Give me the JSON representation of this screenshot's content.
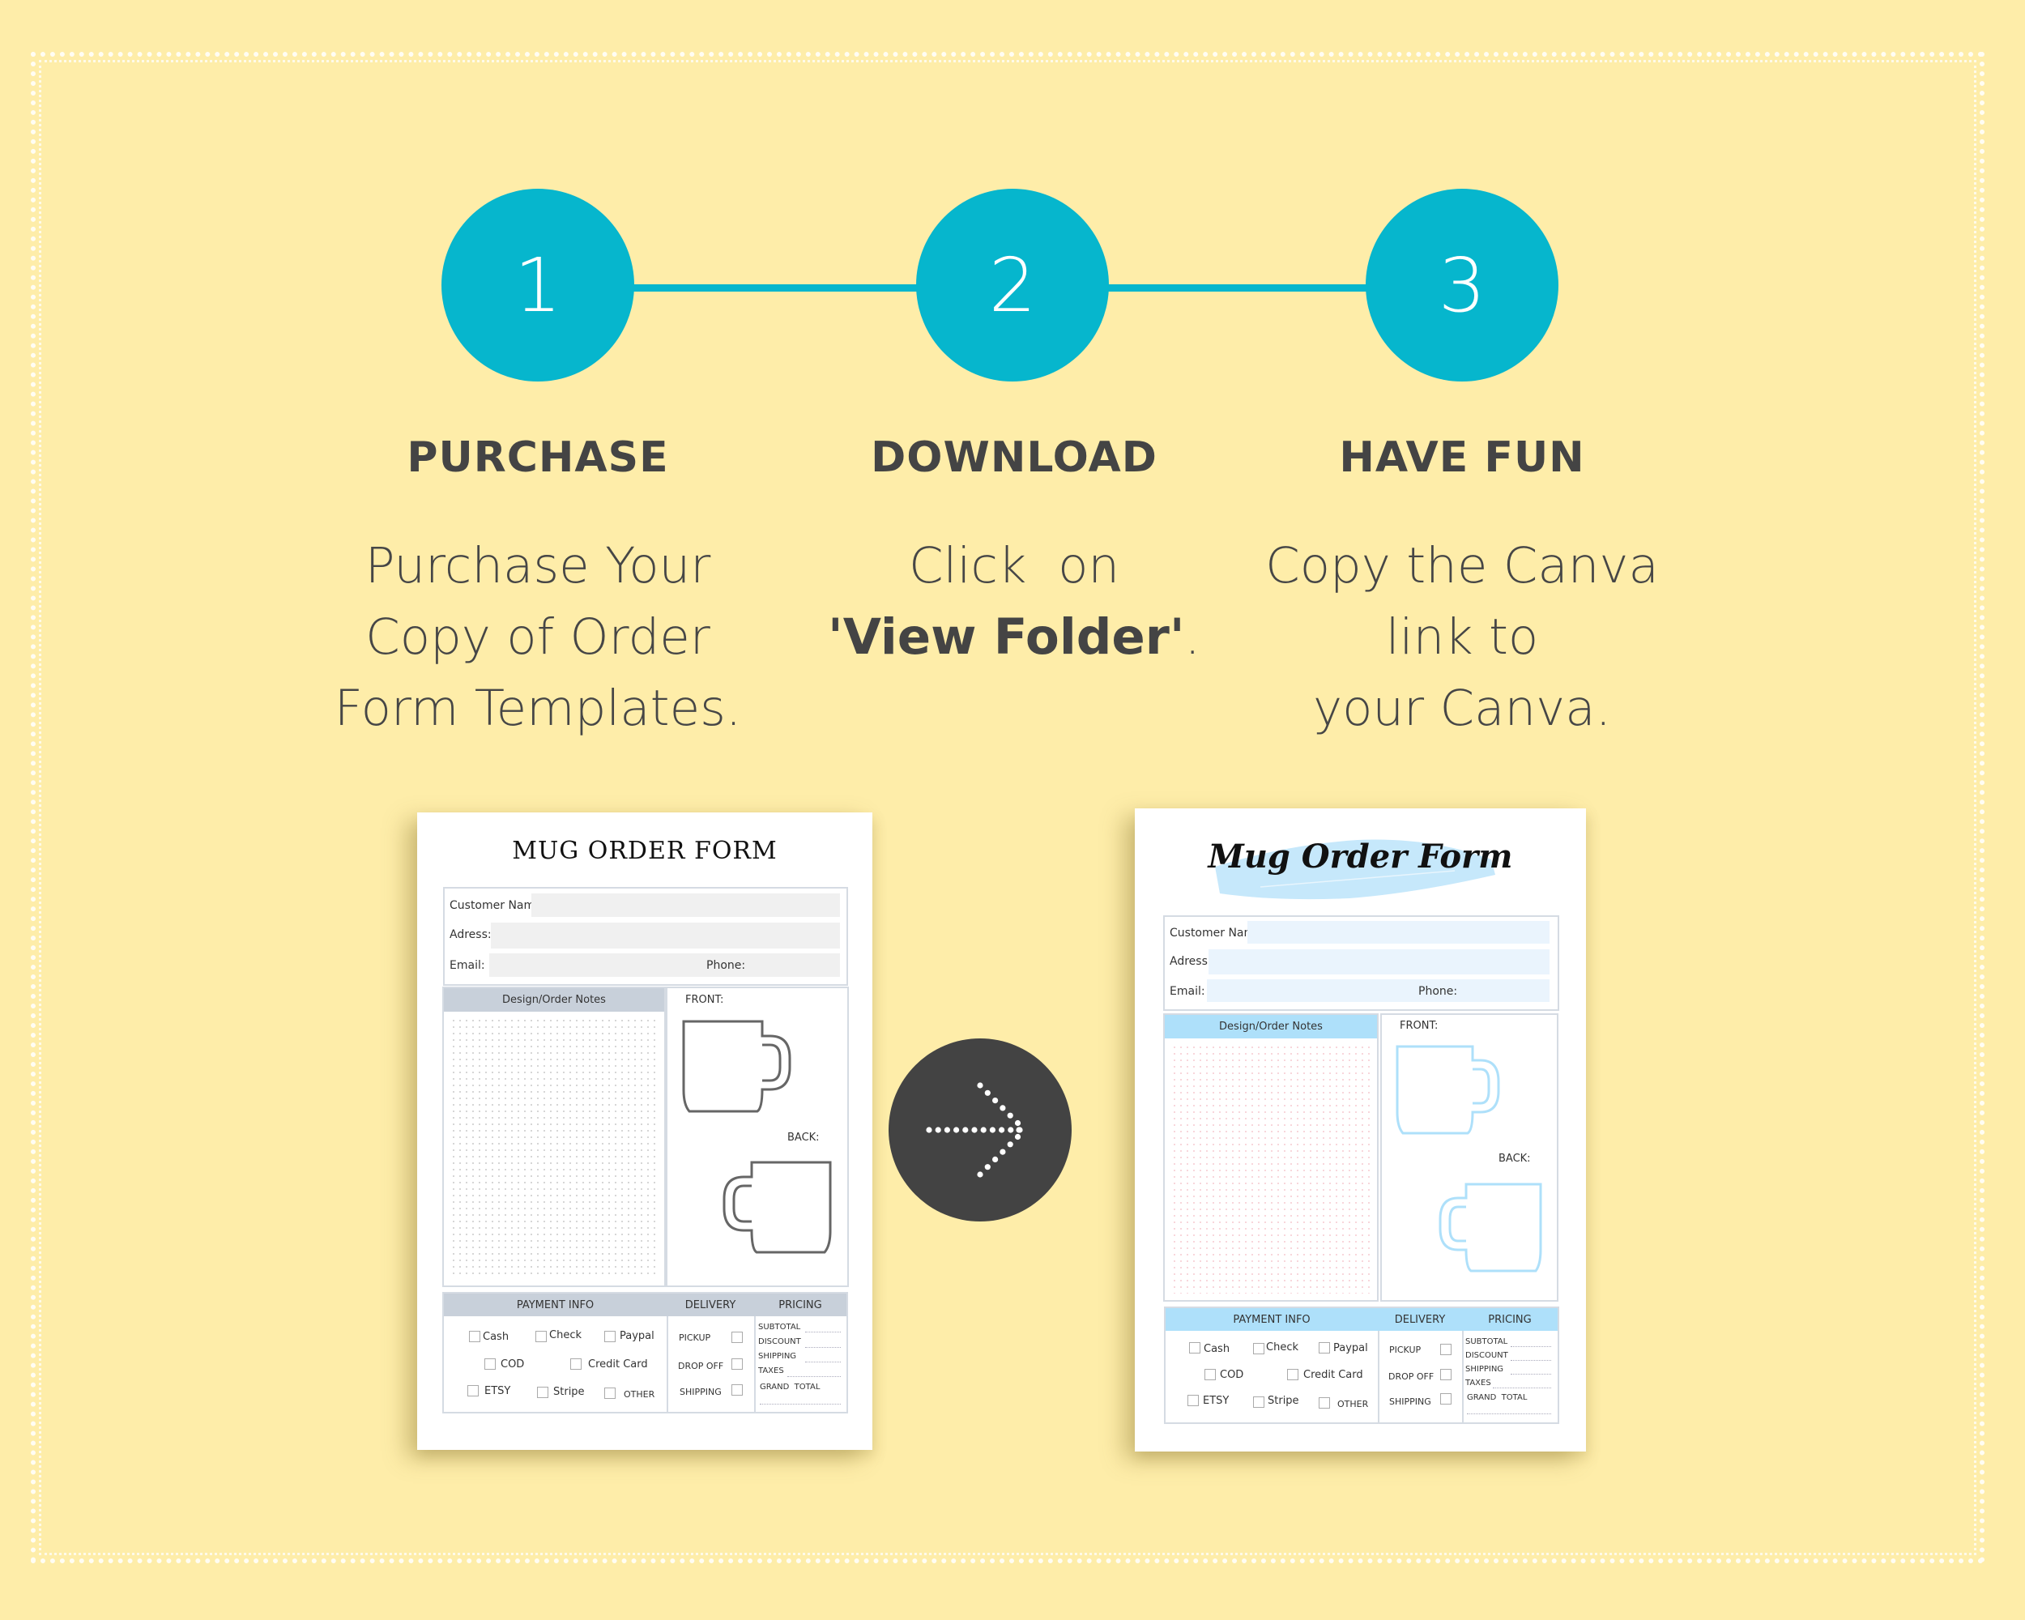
{
  "colors": {
    "background": "#feeda9",
    "accent": "#06b6cd",
    "heading_text": "#444444",
    "arrow_circle": "#434343",
    "form_gray_header": "#c8d0da",
    "form_gray_field": "#f0f0f0",
    "form_blue_header": "#aee0fa",
    "form_blue_field": "#eaf4fd",
    "mug_gray": "#666666",
    "mug_blue": "#aee0fa"
  },
  "steps": [
    {
      "number": "1",
      "title": "PURCHASE",
      "lines": [
        "Purchase Your",
        "Copy of Order",
        "Form Templates."
      ]
    },
    {
      "number": "2",
      "title": "DOWNLOAD",
      "line1": "Click  on",
      "line2_bold": "'View Folder'",
      "line2_tail": "."
    },
    {
      "number": "3",
      "title": "HAVE FUN",
      "lines": [
        "Copy the Canva",
        "link to",
        "your Canva."
      ]
    }
  ],
  "transition_icon": "dotted-arrow-right-icon",
  "forms": {
    "before": {
      "title": "MUG ORDER FORM",
      "fields": {
        "customer_name": "Customer Name:",
        "address": "Adress:",
        "email": "Email:",
        "phone": "Phone:"
      },
      "notes_header": "Design/Order Notes",
      "front_label": "FRONT:",
      "back_label": "BACK:",
      "payment_header": "PAYMENT INFO",
      "delivery_header": "DELIVERY",
      "pricing_header": "PRICING",
      "payment_options": [
        "Cash",
        "Check",
        "Paypal",
        "COD",
        "Credit Card",
        "ETSY",
        "Stripe",
        "OTHER"
      ],
      "delivery_options": [
        "PICKUP",
        "DROP OFF",
        "SHIPPING"
      ],
      "pricing_rows": [
        "SUBTOTAL",
        "DISCOUNT",
        "SHIPPING",
        "TAXES",
        "GRAND  TOTAL"
      ]
    },
    "after": {
      "title": "Mug Order Form",
      "fields": {
        "customer_name": "Customer Name:",
        "address": "Adress:",
        "email": "Email:",
        "phone": "Phone:"
      },
      "notes_header": "Design/Order Notes",
      "front_label": "FRONT:",
      "back_label": "BACK:",
      "payment_header": "PAYMENT INFO",
      "delivery_header": "DELIVERY",
      "pricing_header": "PRICING",
      "payment_options": [
        "Cash",
        "Check",
        "Paypal",
        "COD",
        "Credit Card",
        "ETSY",
        "Stripe",
        "OTHER"
      ],
      "delivery_options": [
        "PICKUP",
        "DROP OFF",
        "SHIPPING"
      ],
      "pricing_rows": [
        "SUBTOTAL",
        "DISCOUNT",
        "SHIPPING",
        "TAXES",
        "GRAND  TOTAL"
      ]
    }
  }
}
